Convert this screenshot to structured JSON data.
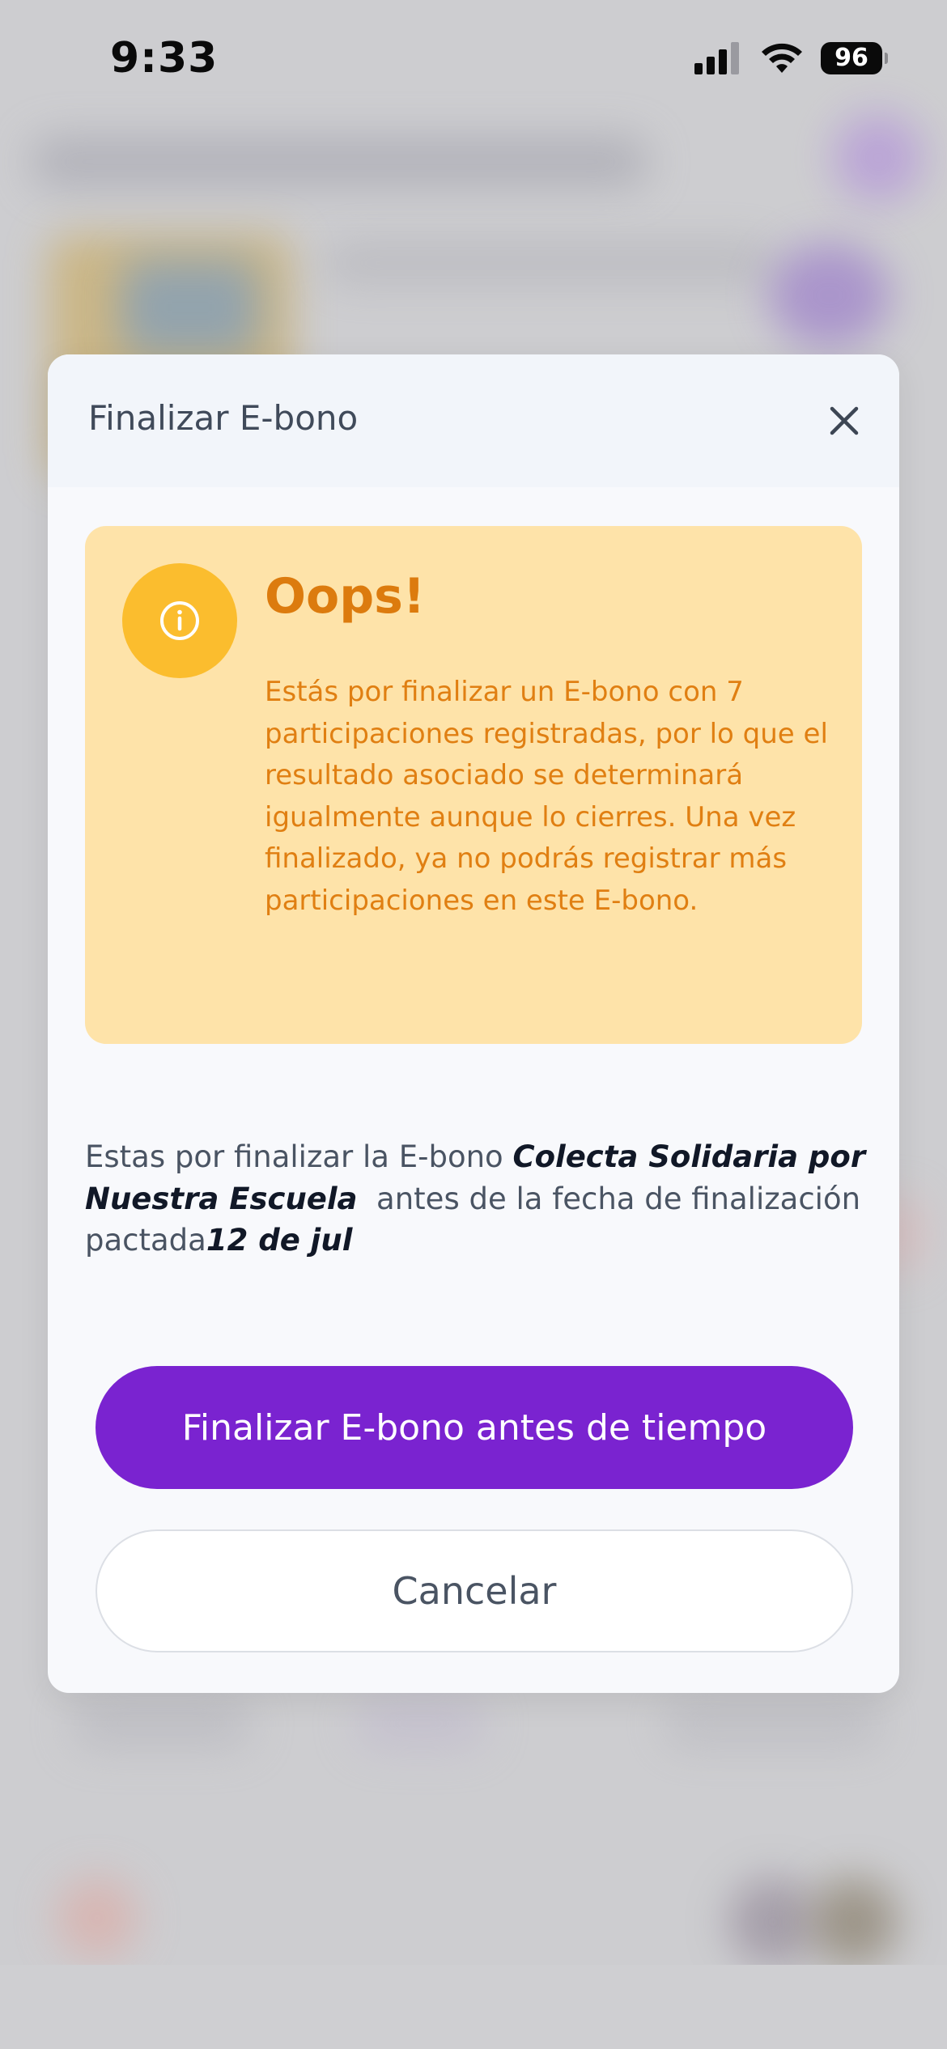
{
  "status_bar": {
    "time": "9:33",
    "battery": "96",
    "icons": [
      "signal-icon",
      "wifi-icon",
      "battery-icon"
    ]
  },
  "modal": {
    "title": "Finalizar E-bono",
    "close_icon": "close-icon",
    "alert": {
      "icon": "info-icon",
      "title": "Oops!",
      "message": "Estás por finalizar un E-bono con 7 participaciones registradas, por lo que el resultado asociado se determinará igualmente aunque lo cierres. Una vez finalizado, ya no podrás registrar más participaciones en este E-bono."
    },
    "description": {
      "prefix": "Estas por finalizar la E-bono ",
      "bono_name": "Colecta Solidaria por Nuestra Escuela",
      "middle": "  antes de la fecha de finalización pactada",
      "end_date": "12 de jul"
    },
    "primary_button": "Finalizar E-bono antes de tiempo",
    "secondary_button": "Cancelar"
  },
  "colors": {
    "accent_purple": "#7a23d0",
    "alert_background": "#fee3a9",
    "alert_text": "#e07f12",
    "alert_icon": "#fbbd2e"
  }
}
